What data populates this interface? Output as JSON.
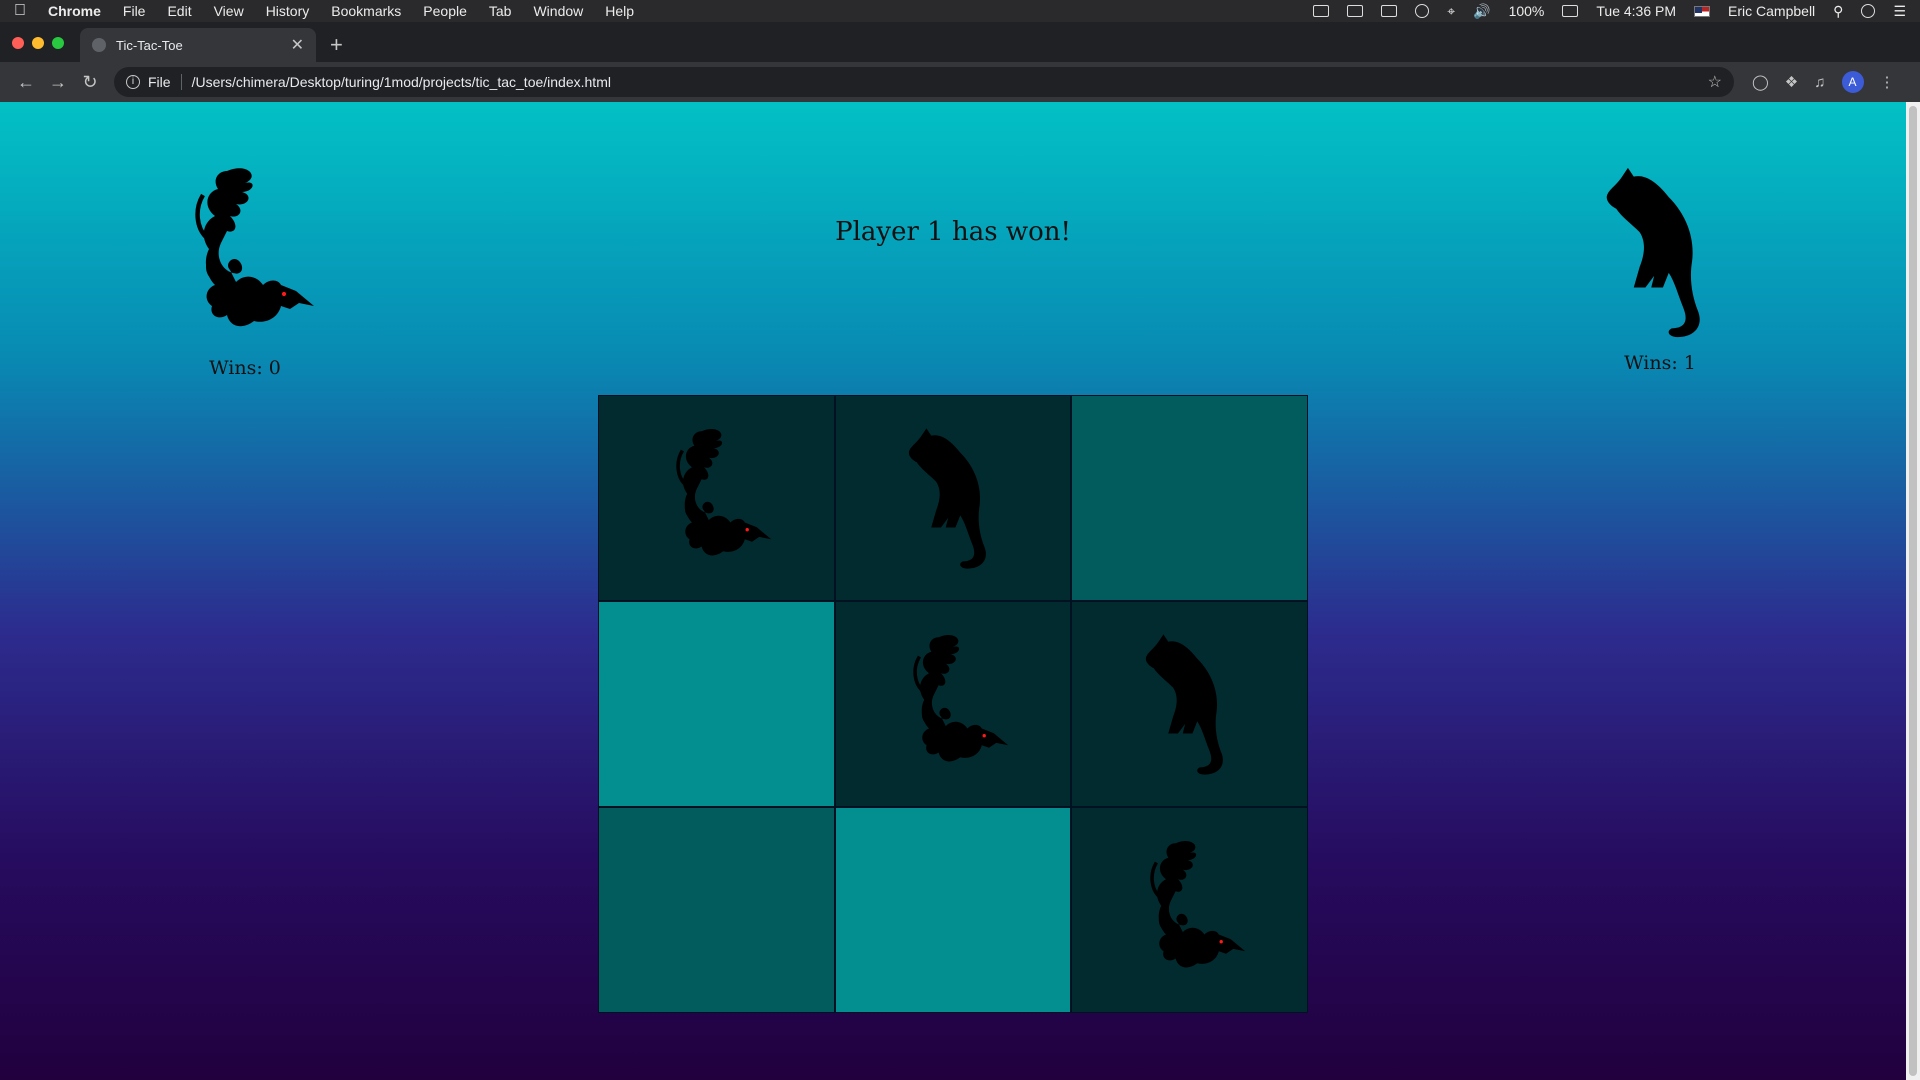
{
  "os_menu": {
    "app_name": "Chrome",
    "items": [
      "File",
      "Edit",
      "View",
      "History",
      "Bookmarks",
      "People",
      "Tab",
      "Window",
      "Help"
    ],
    "battery": "100%",
    "clock": "Tue 4:36 PM",
    "user": "Eric Campbell"
  },
  "browser": {
    "tab_title": "Tic-Tac-Toe",
    "scheme_label": "File",
    "url": "/Users/chimera/Desktop/turing/1mod/projects/tic_tac_toe/index.html",
    "profile_initial": "A"
  },
  "game": {
    "status": "Player 1 has won!",
    "player1": {
      "icon": "dragon-icon",
      "wins_label": "Wins: 0"
    },
    "player2": {
      "icon": "cat-icon",
      "wins_label": "Wins: 1"
    },
    "board": [
      "dragon",
      "cat",
      "",
      "",
      "dragon",
      "cat",
      "",
      "",
      "dragon"
    ],
    "colors": {
      "filled": "#022b2f",
      "empty_dark": "#025b5d",
      "empty_light": "#038e8f",
      "dragon_eye": "#ff1a1a"
    }
  }
}
